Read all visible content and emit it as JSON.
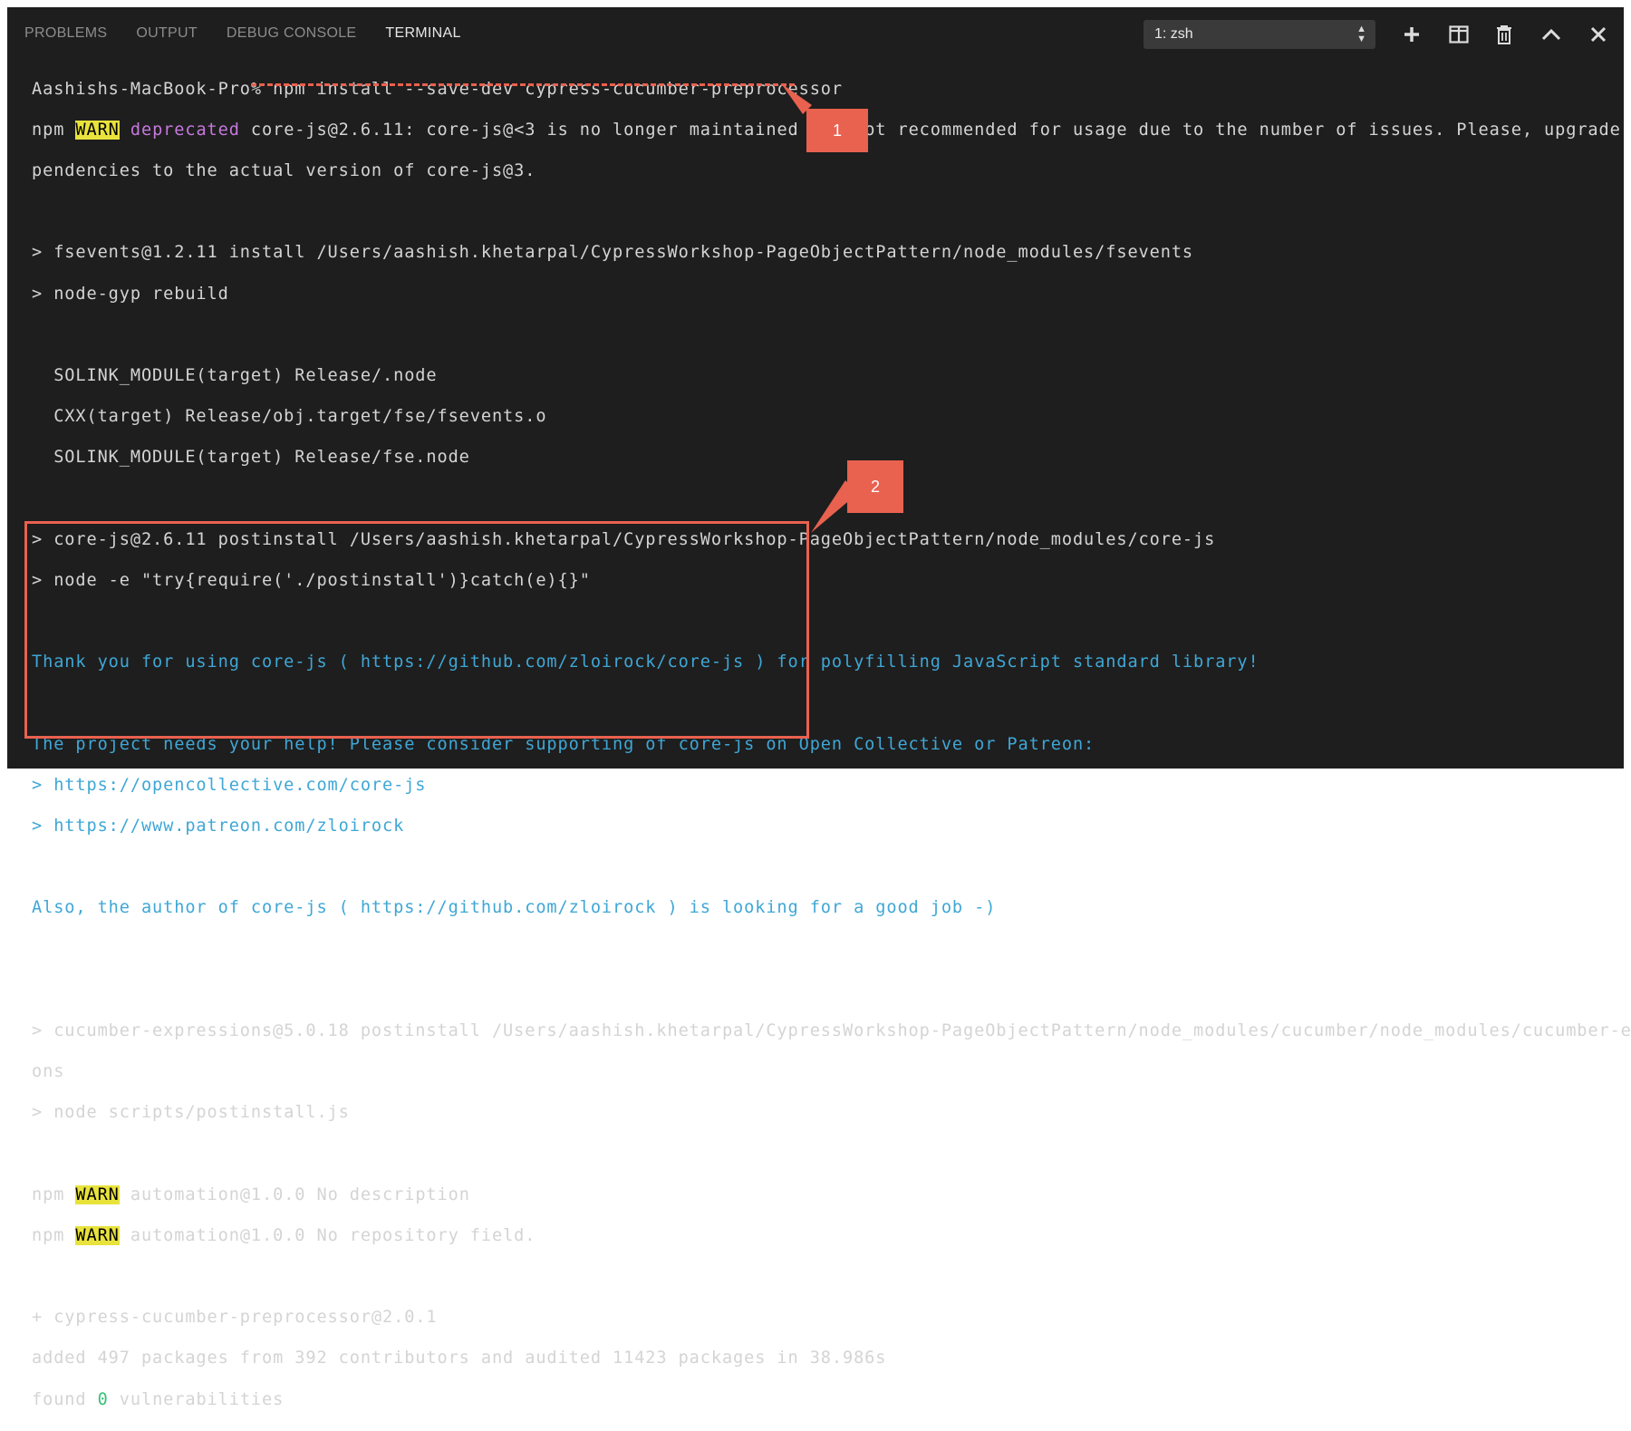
{
  "tabs": [
    {
      "label": "PROBLEMS",
      "active": false
    },
    {
      "label": "OUTPUT",
      "active": false
    },
    {
      "label": "DEBUG CONSOLE",
      "active": false
    },
    {
      "label": "TERMINAL",
      "active": true
    }
  ],
  "terminal_select": {
    "value": "1: zsh"
  },
  "toolbar_icons": [
    "plus-icon",
    "split-terminal-icon",
    "trash-icon",
    "chevron-up-icon",
    "close-icon"
  ],
  "callouts": {
    "one": "1",
    "two": "2"
  },
  "colors": {
    "accent": "#e9614f",
    "warn_bg": "#e8e23c",
    "link": "#3fa7d6",
    "deprecated": "#c678dd",
    "ok": "#39c07a"
  },
  "terminal": {
    "l01": "Aashishs-MacBook-Pro% npm install --save-dev cypress-cucumber-preprocessor",
    "l02_npm": "npm ",
    "l02_warn": "WARN",
    "l02_dep": " deprecated",
    "l02_rest": " core-js@2.6.11: core-js@<3 is no longer maintained and not recommended for usage due to the number of issues. Please, upgrade your de",
    "l03": "pendencies to the actual version of core-js@3.",
    "l05": "> fsevents@1.2.11 install /Users/aashish.khetarpal/CypressWorkshop-PageObjectPattern/node_modules/fsevents",
    "l06": "> node-gyp rebuild",
    "l08": "  SOLINK_MODULE(target) Release/.node",
    "l09": "  CXX(target) Release/obj.target/fse/fsevents.o",
    "l10": "  SOLINK_MODULE(target) Release/fse.node",
    "l12": "> core-js@2.6.11 postinstall /Users/aashish.khetarpal/CypressWorkshop-PageObjectPattern/node_modules/core-js",
    "l13": "> node -e \"try{require('./postinstall')}catch(e){}\"",
    "l15": "Thank you for using core-js ( https://github.com/zloirock/core-js ) for polyfilling JavaScript standard library!",
    "l17": "The project needs your help! Please consider supporting of core-js on Open Collective or Patreon:",
    "l18": "> https://opencollective.com/core-js",
    "l19": "> https://www.patreon.com/zloirock",
    "l21": "Also, the author of core-js ( https://github.com/zloirock ) is looking for a good job -)",
    "l24": "> cucumber-expressions@5.0.18 postinstall /Users/aashish.khetarpal/CypressWorkshop-PageObjectPattern/node_modules/cucumber/node_modules/cucumber-expressi",
    "l25": "ons",
    "l26": "> node scripts/postinstall.js",
    "l28_npm": "npm ",
    "l28_warn": "WARN",
    "l28_rest": " automation@1.0.0 No description",
    "l29_npm": "npm ",
    "l29_warn": "WARN",
    "l29_rest": " automation@1.0.0 No repository field.",
    "l31": "+ cypress-cucumber-preprocessor@2.0.1",
    "l32": "added 497 packages from 392 contributors and audited 11423 packages in 38.986s",
    "l33_a": "found ",
    "l33_b": "0",
    "l33_c": " vulnerabilities"
  }
}
